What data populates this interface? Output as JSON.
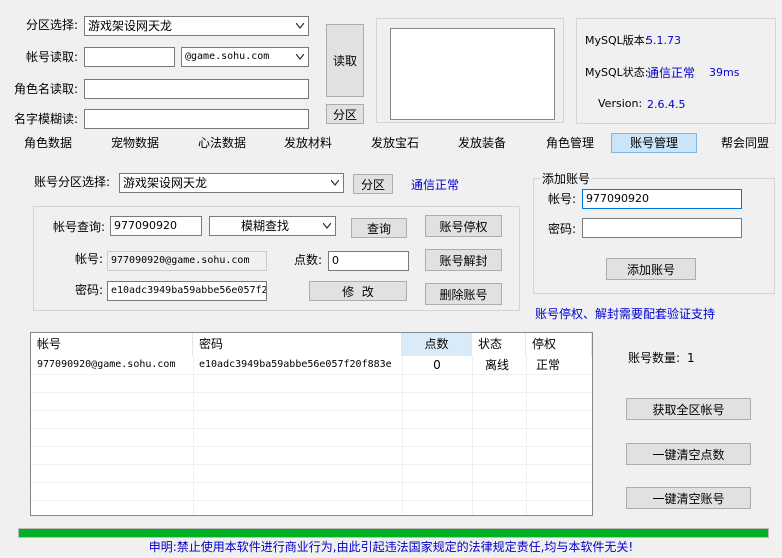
{
  "login": {
    "zone_label": "分区选择:",
    "zone_value": "游戏架设网天龙",
    "account_read_label": "帐号读取:",
    "account_read_value": "",
    "domain_value": "@game.sohu.com",
    "role_read_label": "角色名读取:",
    "role_read_value": "",
    "fuzzy_label": "名字模糊读:",
    "fuzzy_value": "",
    "read_button": "读取",
    "zone_button": "分区"
  },
  "mysql": {
    "version_label": "MySQL版本:",
    "version_value": "5.1.73",
    "status_label": "MySQL状态:",
    "status_value": "通信正常",
    "latency": "39ms",
    "ver_label": "Version:",
    "ver_value": "2.6.4.5"
  },
  "tabs": [
    "角色数据",
    "宠物数据",
    "心法数据",
    "发放材料",
    "发放宝石",
    "发放装备",
    "角色管理",
    "账号管理",
    "帮会同盟"
  ],
  "active_tab_index": 7,
  "account": {
    "zone_label": "账号分区选择:",
    "zone_value": "游戏架设网天龙",
    "zone_button": "分区",
    "comm_status": "通信正常",
    "query_label": "帐号查询:",
    "query_value": "977090920",
    "query_mode": "模糊查找",
    "query_button": "查询",
    "suspend_button": "账号停权",
    "acc_label": "帐号:",
    "acc_value": "977090920@game.sohu.com",
    "points_label": "点数:",
    "points_value": "0",
    "unsuspend_button": "账号解封",
    "pwd_label": "密码:",
    "pwd_value": "e10adc3949ba59abbe56e057f2",
    "modify_button": "修  改",
    "delete_button": "删除账号"
  },
  "add_account": {
    "group_title": "添加账号",
    "acc_label": "帐号:",
    "acc_value": "977090920",
    "pwd_label": "密码:",
    "pwd_value": "",
    "add_button": "添加账号"
  },
  "notice": "账号停权、解封需要配套验证支持",
  "table": {
    "headers": [
      "帐号",
      "密码",
      "点数",
      "状态",
      "停权"
    ],
    "rows": [
      [
        "977090920@game.sohu.com",
        "e10adc3949ba59abbe56e057f20f883e",
        "0",
        "离线",
        "正常"
      ]
    ]
  },
  "account_count_label": "账号数量:",
  "account_count_value": "1",
  "side_buttons": {
    "fetch_all": "获取全区帐号",
    "clear_points": "一键清空点数",
    "clear_accounts": "一键清空账号"
  },
  "progress": 1.0,
  "footer": "申明:禁止使用本软件进行商业行为,由此引起违法国家规定的法律规定责任,均与本软件无关!",
  "colors": {
    "accent_blue": "#0000cc",
    "progress_green": "#06b025",
    "active_tab": "#cce4f7",
    "header_selected": "#d9ebf9"
  }
}
